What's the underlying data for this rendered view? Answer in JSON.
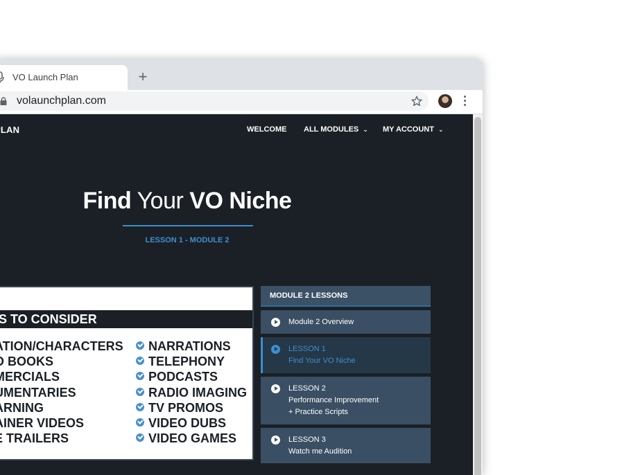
{
  "browser": {
    "tab_title": "VO Launch Plan",
    "new_tab_glyph": "+",
    "url": "volaunchplan.com",
    "icons": [
      "mic-icon",
      "lock-icon",
      "star-icon",
      "avatar",
      "menu-icon"
    ]
  },
  "site": {
    "brand": "PLAN",
    "nav": {
      "welcome": "WELCOME",
      "all_modules": "ALL MODULES",
      "my_account": "MY ACCOUNT",
      "chevron": "⌄"
    },
    "hero": {
      "title_part1": "Find",
      "title_part2": " Your ",
      "title_part3": "VO Niche",
      "subtitle": "LESSON 1 - MODULE 2"
    },
    "slide": {
      "bar_text": "S TO CONSIDER",
      "left_items": [
        "ATION/CHARACTERS",
        "O BOOKS",
        "MERCIALS",
        "UMENTARIES",
        "ARNING",
        "AINER VIDEOS",
        "E TRAILERS"
      ],
      "right_items": [
        "NARRATIONS",
        "TELEPHONY",
        "PODCASTS",
        "RADIO IMAGING",
        "TV PROMOS",
        "VIDEO DUBS",
        "VIDEO GAMES"
      ]
    },
    "lessons": {
      "header": "MODULE 2 LESSONS",
      "items": [
        {
          "line1": "Module 2 Overview"
        },
        {
          "line1": "LESSON 1",
          "line2": "Find Your VO Niche"
        },
        {
          "line1": "LESSON 2",
          "line2": "Performance Improvement",
          "line3": "+ Practice Scripts"
        },
        {
          "line1": "LESSON 3",
          "line2": "Watch me Audition"
        }
      ]
    }
  },
  "colors": {
    "page_bg": "#1b2026",
    "accent": "#3d8fd1",
    "lesson_bg": "#3a4f63",
    "lesson_active_bg": "#253847"
  }
}
